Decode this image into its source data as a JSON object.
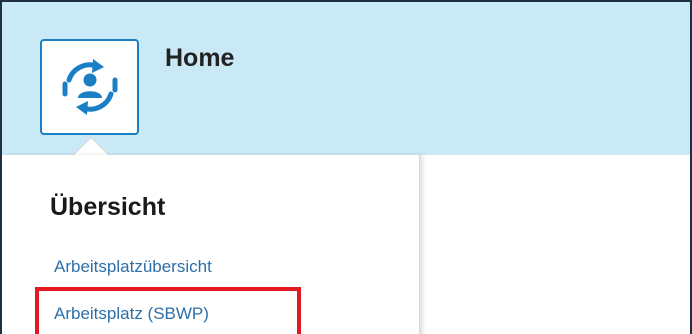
{
  "header": {
    "title": "Home",
    "tile_icon": "person-refresh-icon",
    "accent_color": "#1a7fc4",
    "background_color": "#c9e9f6"
  },
  "menu": {
    "section_title": "Übersicht",
    "items": [
      {
        "label": "Arbeitsplatzübersicht",
        "highlighted": false
      },
      {
        "label": "Arbeitsplatz (SBWP)",
        "highlighted": true
      }
    ],
    "link_color": "#2d6fa8",
    "highlight_color": "#e21b22"
  }
}
